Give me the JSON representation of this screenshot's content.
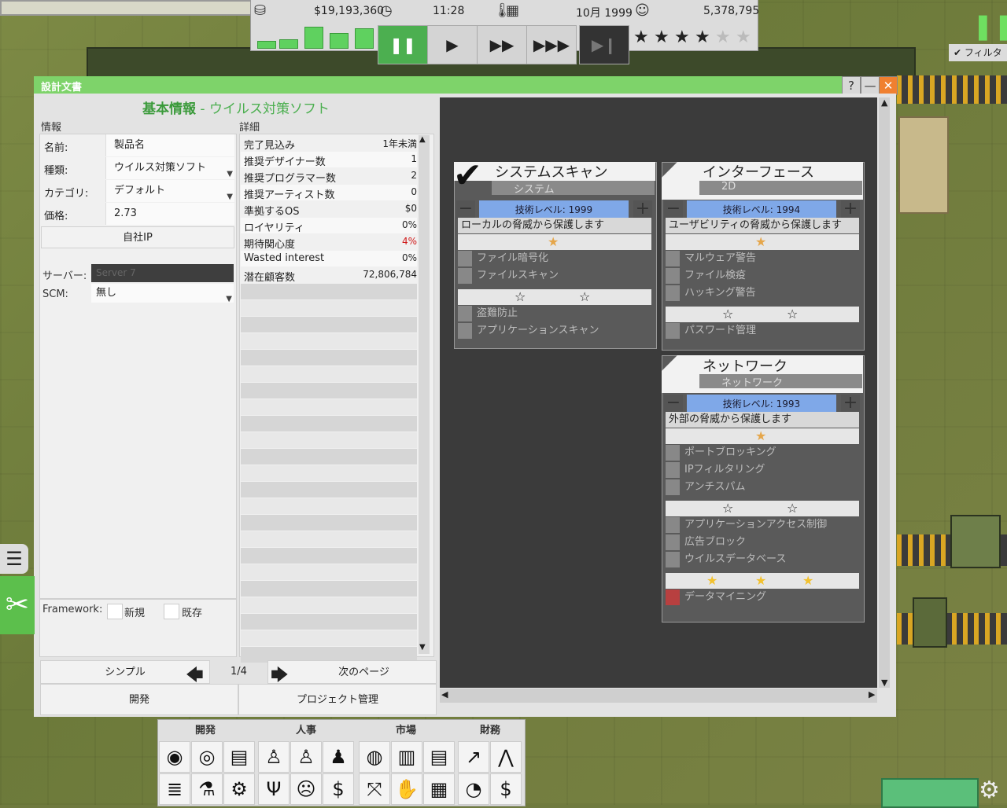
{
  "hud": {
    "money": "$19,193,360",
    "time": "11:28",
    "date": "10月 1999",
    "fans": "5,378,795",
    "rating_stars": 4,
    "rating_max": 5
  },
  "window": {
    "title": "設計文書",
    "help": "?",
    "minimize": "—",
    "close": "✕"
  },
  "basic": {
    "title_main": "基本情報",
    "title_sep": " - ",
    "title_sub": "ウイルス対策ソフト",
    "section_info": "情報",
    "section_detail": "詳細"
  },
  "info": {
    "name_label": "名前:",
    "name_value": "製品名",
    "type_label": "種類:",
    "type_value": "ウイルス対策ソフト",
    "category_label": "カテゴリ:",
    "category_value": "デフォルト",
    "price_label": "価格:",
    "price_value": "2.73",
    "inhouse_ip": "自社IP",
    "server_label": "サーバー:",
    "server_value": "Server 7",
    "scm_label": "SCM:",
    "scm_value": "無し",
    "framework_label": "Framework:",
    "framework_new": "新規",
    "framework_existing": "既存"
  },
  "details": [
    {
      "k": "完了見込み",
      "v": "1年未満",
      "red": false
    },
    {
      "k": "推奨デザイナー数",
      "v": "1",
      "red": false
    },
    {
      "k": "推奨プログラマー数",
      "v": "2",
      "red": false
    },
    {
      "k": "推奨アーティスト数",
      "v": "0",
      "red": false
    },
    {
      "k": "準拠するOS",
      "v": "$0",
      "red": false
    },
    {
      "k": "ロイヤリティ",
      "v": "0%",
      "red": false
    },
    {
      "k": "期待関心度",
      "v": "4%",
      "red": true
    },
    {
      "k": "Wasted interest",
      "v": "0%",
      "red": false
    },
    {
      "k": "潜在顧客数",
      "v": "72,806,784",
      "red": false
    }
  ],
  "nav": {
    "simple": "シンプル",
    "page": "1/4",
    "next": "次のページ",
    "develop": "開発",
    "project_mgmt": "プロジェクト管理"
  },
  "features": {
    "system_scan": {
      "name": "システムスキャン",
      "sub": "システム",
      "tech": "技術レベル: 1999",
      "desc": "ローカルの脅威から保護します",
      "opts1": [
        "ファイル暗号化",
        "ファイルスキャン"
      ],
      "opts2": [
        "盗難防止",
        "アプリケーションスキャン"
      ]
    },
    "interface": {
      "name": "インターフェース",
      "sub": "2D",
      "tech": "技術レベル: 1994",
      "desc": "ユーザビリティの脅威から保護します",
      "opts1": [
        "マルウェア警告",
        "ファイル検疫",
        "ハッキング警告"
      ],
      "opts2": [
        "パスワード管理"
      ]
    },
    "network": {
      "name": "ネットワーク",
      "sub": "ネットワーク",
      "tech": "技術レベル: 1993",
      "desc": "外部の脅威から保護します",
      "opts1": [
        "ポートブロッキング",
        "IPフィルタリング",
        "アンチスパム"
      ],
      "opts2": [
        "アプリケーションアクセス制御",
        "広告ブロック",
        "ウイルスデータベース"
      ],
      "opts3": [
        "データマイニング"
      ]
    }
  },
  "toolbar": {
    "groups": [
      "開発",
      "人事",
      "市場",
      "財務"
    ]
  },
  "filter": "フィルタ"
}
